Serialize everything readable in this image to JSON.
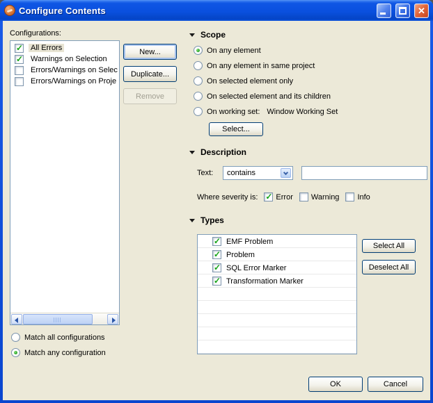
{
  "window": {
    "title": "Configure Contents",
    "icons": {
      "titlebar": "filter-icon",
      "minimize": "minimize-icon",
      "maximize": "maximize-icon",
      "close": "close-icon"
    }
  },
  "colors": {
    "titlebar_blue": "#0b51dc",
    "body_background": "#ece9d8",
    "control_border": "#7f9db9",
    "button_border": "#003c74",
    "check_green": "#15a315",
    "close_red": "#d9542a",
    "selection_background": "#e8e4d3"
  },
  "configurations": {
    "label": "Configurations:",
    "items": [
      {
        "label": "All Errors",
        "checked": true,
        "selected": true
      },
      {
        "label": "Warnings on Selection",
        "checked": true,
        "selected": false
      },
      {
        "label": "Errors/Warnings on Selec",
        "checked": false,
        "selected": false
      },
      {
        "label": "Errors/Warnings on Proje",
        "checked": false,
        "selected": false
      }
    ],
    "buttons": {
      "new": "New...",
      "duplicate": "Duplicate...",
      "remove": "Remove"
    },
    "match_options": [
      {
        "label": "Match all configurations",
        "selected": false
      },
      {
        "label": "Match any configuration",
        "selected": true
      }
    ]
  },
  "scope": {
    "header": "Scope",
    "options": [
      {
        "label": "On any element",
        "selected": true
      },
      {
        "label": "On any element in same project",
        "selected": false
      },
      {
        "label": "On selected element only",
        "selected": false
      },
      {
        "label": "On selected element and its children",
        "selected": false
      },
      {
        "label": "On working set:",
        "value": "Window Working Set",
        "selected": false
      }
    ],
    "select_button": "Select..."
  },
  "description": {
    "header": "Description",
    "text_label": "Text:",
    "combo_value": "contains",
    "input_value": "",
    "severity_label": "Where severity is:",
    "severity_options": [
      {
        "label": "Error",
        "checked": true
      },
      {
        "label": "Warning",
        "checked": false
      },
      {
        "label": "Info",
        "checked": false
      }
    ]
  },
  "types": {
    "header": "Types",
    "items": [
      {
        "label": "EMF Problem",
        "checked": true
      },
      {
        "label": "Problem",
        "checked": true
      },
      {
        "label": "SQL Error Marker",
        "checked": true
      },
      {
        "label": "Transformation Marker",
        "checked": true
      }
    ],
    "buttons": {
      "select_all": "Select All",
      "deselect_all": "Deselect All"
    }
  },
  "footer": {
    "ok": "OK",
    "cancel": "Cancel"
  }
}
